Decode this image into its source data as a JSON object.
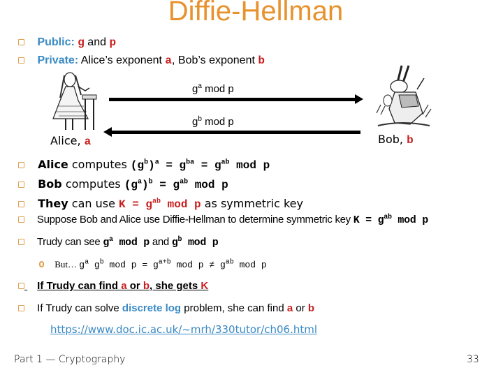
{
  "title": "Diffie-Hellman",
  "top_bullets": [
    {
      "label": "Public:",
      "parts": [
        {
          "t": "g",
          "cls": "red mono"
        },
        {
          "t": " and ",
          "cls": ""
        },
        {
          "t": "p",
          "cls": "red mono"
        }
      ]
    },
    {
      "label": "Private:",
      "parts": [
        {
          "t": "Alice’s exponent ",
          "cls": ""
        },
        {
          "t": "a",
          "cls": "red"
        },
        {
          "t": ", Bob’s exponent ",
          "cls": ""
        },
        {
          "t": "b",
          "cls": "red"
        }
      ]
    }
  ],
  "diagram": {
    "alice_label": "Alice, ",
    "alice_var": "a",
    "bob_label": "Bob, ",
    "bob_var": "b",
    "msg_to_bob_base": "g",
    "msg_to_bob_exp": "a",
    "msg_to_bob_rest": " mod p",
    "msg_to_alice_base": "g",
    "msg_to_alice_exp": "b",
    "msg_to_alice_rest": " mod p",
    "alice_icon": "alice-illustration",
    "bob_icon": "white-rabbit-illustration"
  },
  "compute_lines": {
    "alice": {
      "who": "Alice",
      "verb": " computes ",
      "formula": "(g<sup>b</sup>)<sup>a</sup> = g<sup>ba</sup> = g<sup>ab</sup> mod p"
    },
    "bob": {
      "who": "Bob",
      "verb": " computes ",
      "formula": "(g<sup>a</sup>)<sup>b</sup> = g<sup>ab</sup> mod p"
    },
    "they": {
      "who": "They",
      "verb": " can use ",
      "key": "K = g<sup>ab</sup> mod p",
      "rest": " as symmetric key"
    }
  },
  "suppose_line": {
    "text": "Suppose Bob and Alice use Diffie-Hellman to determine symmetric key ",
    "formula": "K = g<sup>ab</sup> mod p"
  },
  "trudy_line": {
    "text1": "Trudy can see ",
    "f1": "g<sup>a</sup> mod p",
    "text2": " and ",
    "f2": "g<sup>b</sup> mod p"
  },
  "but_line": {
    "prefix": "But… ",
    "formula": "g<sup>a</sup> g<sup>b</sup> mod p = g<sup>a+b</sup> mod p ≠ g<sup>ab</sup> mod p"
  },
  "find_line": {
    "t1": "If Trudy can find ",
    "a": "a",
    "t2": " or ",
    "b": "b",
    "t3": ", she gets ",
    "k": "K"
  },
  "log_line": {
    "t1": "If Trudy can solve ",
    "highlight": "discrete log",
    "t2": " problem, she can find ",
    "a": "a",
    "t3": " or ",
    "b": "b"
  },
  "url": "https://www.doc.ic.ac.uk/~mrh/330tutor/ch06.html",
  "footer": {
    "left": "Part 1 — Cryptography",
    "page": "33"
  },
  "colors": {
    "title": "#e8922e",
    "accent_blue": "#3a8ac4",
    "accent_red": "#c81e1e",
    "bullet": "#e0a050"
  }
}
